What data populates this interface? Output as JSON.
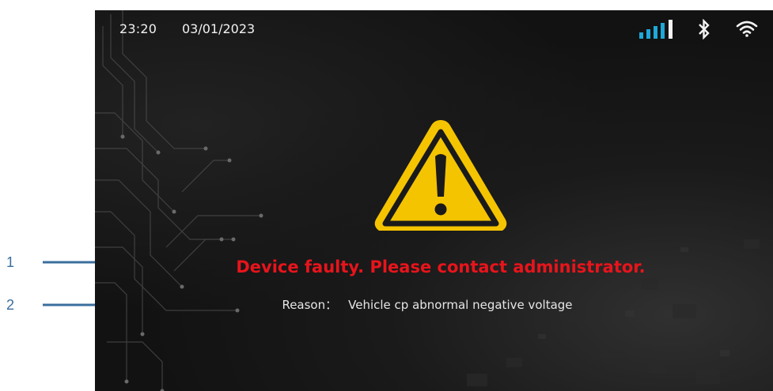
{
  "callouts": [
    {
      "number": "1"
    },
    {
      "number": "2"
    }
  ],
  "statusbar": {
    "time": "23:20",
    "date": "03/01/2023",
    "icons": [
      "signal-icon",
      "bluetooth-icon",
      "wifi-icon"
    ],
    "signal_color": "#1ea7d8"
  },
  "alert": {
    "icon": "warning-icon",
    "title": "Device faulty. Please contact administrator.",
    "reason_label": "Reason：",
    "reason_text": "Vehicle cp abnormal negative voltage"
  },
  "colors": {
    "screen_background": "#121212",
    "error_red": "#e8141b",
    "warning_yellow": "#f5c400",
    "callout_blue": "#3a6e9e"
  }
}
